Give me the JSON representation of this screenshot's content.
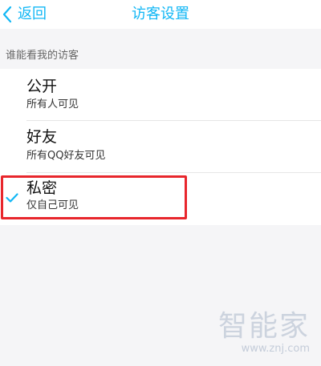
{
  "navbar": {
    "back_label": "返回",
    "title": "访客设置"
  },
  "section": {
    "header": "谁能看我的访客"
  },
  "options": [
    {
      "title": "公开",
      "subtitle": "所有人可见",
      "selected": false
    },
    {
      "title": "好友",
      "subtitle": "所有QQ好友可见",
      "selected": false
    },
    {
      "title": "私密",
      "subtitle": "仅自己可见",
      "selected": true
    }
  ],
  "colors": {
    "accent": "#12b7f5",
    "highlight": "#e8262c",
    "background": "#f5f5f7"
  },
  "watermark": {
    "logo": "智能家",
    "url": "www.znj.com"
  }
}
